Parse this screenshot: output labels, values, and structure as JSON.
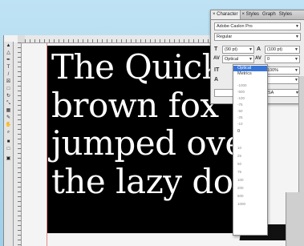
{
  "document": {
    "lines": [
      "The Quick",
      "brown fox",
      "jumped over",
      "the lazy dog."
    ]
  },
  "character_panel": {
    "tabs": [
      "× Character",
      "× Styles",
      "Graph",
      "Styles"
    ],
    "font_family": "Adobe Caslon Pro",
    "font_style": "Regular",
    "font_size": "(90 pt)",
    "leading": "(100 pt)",
    "kerning": "Optical",
    "tracking": "0",
    "vertical_scale": "100%",
    "horizontal_scale": "100%",
    "language": "USA"
  },
  "kerning_menu": {
    "items": [
      "Optical",
      "Metrics",
      "-1000",
      "-500",
      "-100",
      "-75",
      "-50",
      "-25",
      "-10",
      "0",
      "10",
      "25",
      "50",
      "75",
      "100",
      "200",
      "500",
      "1000"
    ],
    "selected": "Optical"
  },
  "colors": {
    "background": "#aed8ec",
    "text_frame": "#000000",
    "selection": "#3875d7"
  }
}
